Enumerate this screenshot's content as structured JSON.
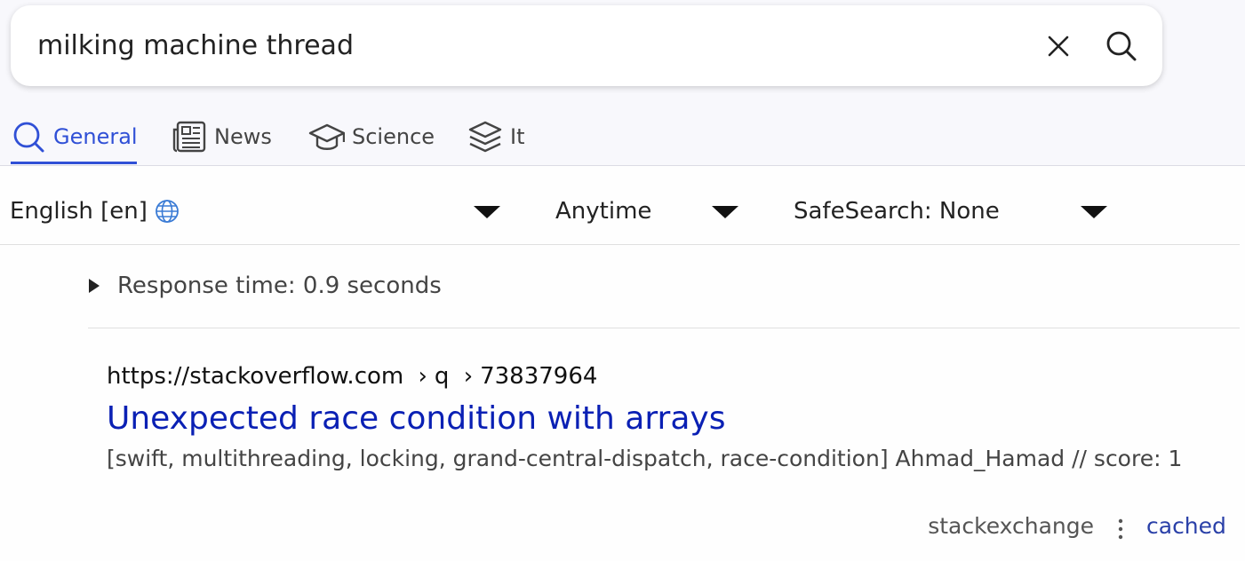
{
  "search": {
    "query": "milking machine thread"
  },
  "tabs": [
    {
      "label": "General",
      "icon": "search-icon",
      "active": true
    },
    {
      "label": "News",
      "icon": "newspaper-icon",
      "active": false
    },
    {
      "label": "Science",
      "icon": "graduation-cap-icon",
      "active": false
    },
    {
      "label": "It",
      "icon": "layers-icon",
      "active": false
    }
  ],
  "filters": {
    "language": "English [en]",
    "time": "Anytime",
    "safesearch": "SafeSearch: None"
  },
  "response": {
    "label": "Response time: 0.9 seconds"
  },
  "result": {
    "url_base": "https://stackoverflow.com",
    "url_path_1": "q",
    "url_path_2": "73837964",
    "title": "Unexpected race condition with arrays",
    "snippet": "[swift, multithreading, locking, grand-central-dispatch, race-condition] Ahmad_Hamad // score: 1",
    "engine": "stackexchange",
    "cached_label": "cached"
  },
  "colors": {
    "accent": "#3050d6",
    "link": "#0a20b4",
    "cached_link": "#2a40a8"
  }
}
